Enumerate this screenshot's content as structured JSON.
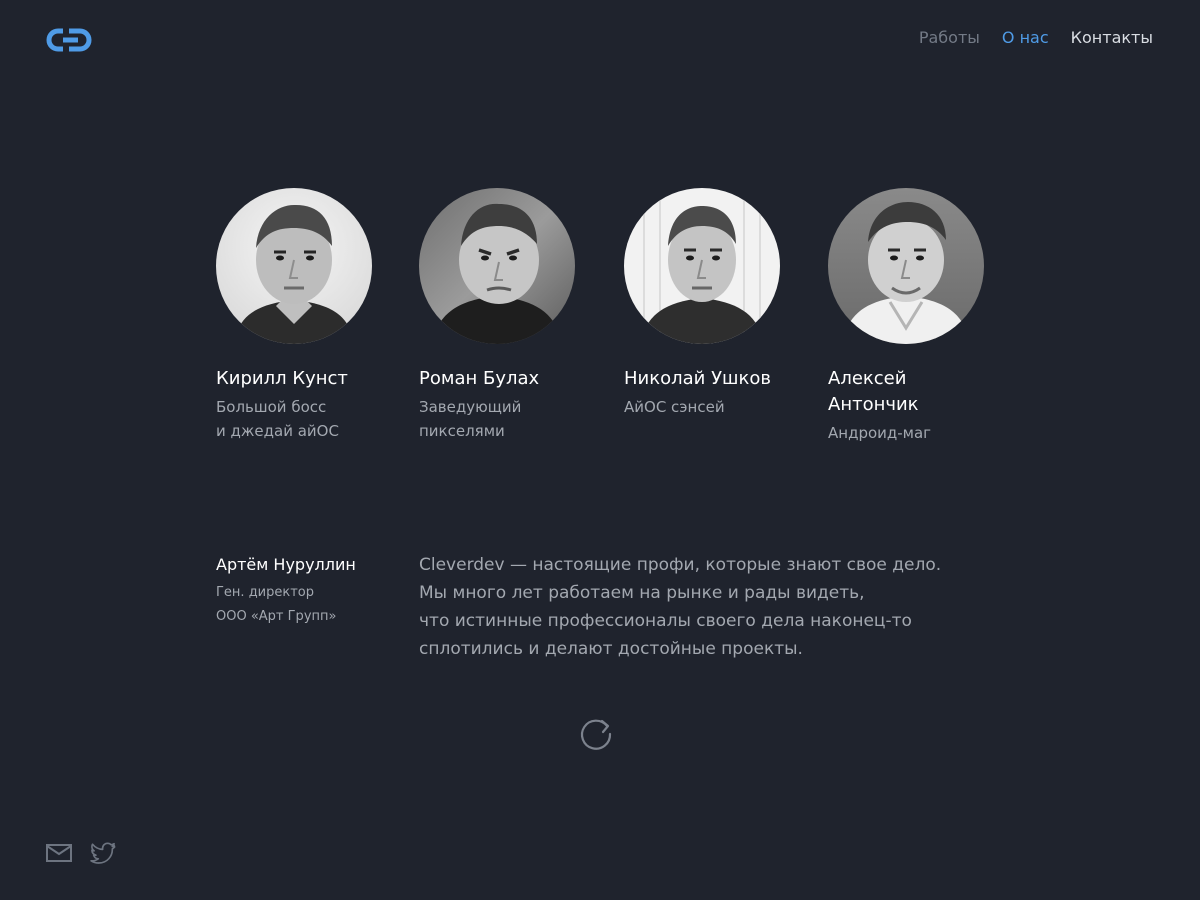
{
  "brand": {
    "logo_icon": "cleverdev-logo",
    "accent": "#4f9be6"
  },
  "nav": {
    "items": [
      {
        "label": "Работы",
        "state": "normal"
      },
      {
        "label": "О нас",
        "state": "active"
      },
      {
        "label": "Контакты",
        "state": "normal"
      }
    ]
  },
  "team": [
    {
      "name": "Кирилл Кунст",
      "role": [
        "Большой босс",
        "и джедай айОС"
      ]
    },
    {
      "name": "Роман Булах",
      "role": [
        "Заведующий",
        "пикселями"
      ]
    },
    {
      "name": "Николай Ушков",
      "role": [
        "АйОС сэнсей"
      ]
    },
    {
      "name": "Алексей Антончик",
      "role": [
        "Андроид-маг"
      ]
    }
  ],
  "testimonial": {
    "author_name": "Артём Нуруллин",
    "author_role": [
      "Ген. директор",
      "ООО «Арт Групп»"
    ],
    "quote_lines": [
      "Cleverdev — настоящие профи, которые знают свое дело.",
      "Мы много лет работаем на рынке и рады видеть,",
      "что истинные профессионалы своего дела наконец-то",
      "сплотились и делают достойные проекты."
    ]
  },
  "controls": {
    "reload_icon": "refresh-icon"
  },
  "footer": {
    "icons": [
      "mail-icon",
      "twitter-icon"
    ]
  }
}
